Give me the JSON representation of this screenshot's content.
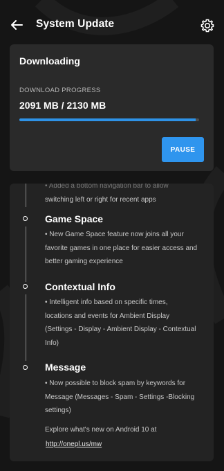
{
  "header": {
    "title": "System Update",
    "back_icon": "arrow-left-icon",
    "settings_icon": "gear-icon"
  },
  "download": {
    "title": "Downloading",
    "progress_label": "DOWNLOAD PROGRESS",
    "amount": "2091 MB / 2130 MB",
    "progress_fraction": 0.982,
    "pause_label": "PAUSE",
    "accent_color": "#2f95ee"
  },
  "changelog": {
    "partial_top_faded": "• Added a bottom navigation bar to allow",
    "partial_top": "switching left or right for recent apps",
    "sections": [
      {
        "title": "Game Space",
        "lines": [
          "• New Game Space feature now joins all your",
          "favorite games in one place for easier access and",
          "better gaming experience"
        ]
      },
      {
        "title": "Contextual Info",
        "lines": [
          "• Intelligent info based on specific times,",
          "locations and events for Ambient Display",
          "(Settings - Display - Ambient Display -  Contextual",
          "Info)"
        ]
      },
      {
        "title": "Message",
        "lines": [
          "• Now possible to block spam by keywords for",
          "Message (Messages - Spam - Settings -Blocking",
          "settings)"
        ]
      }
    ],
    "explore_text": "Explore what's new on Android 10 at",
    "link_text": "http://onepl.us/mw"
  }
}
